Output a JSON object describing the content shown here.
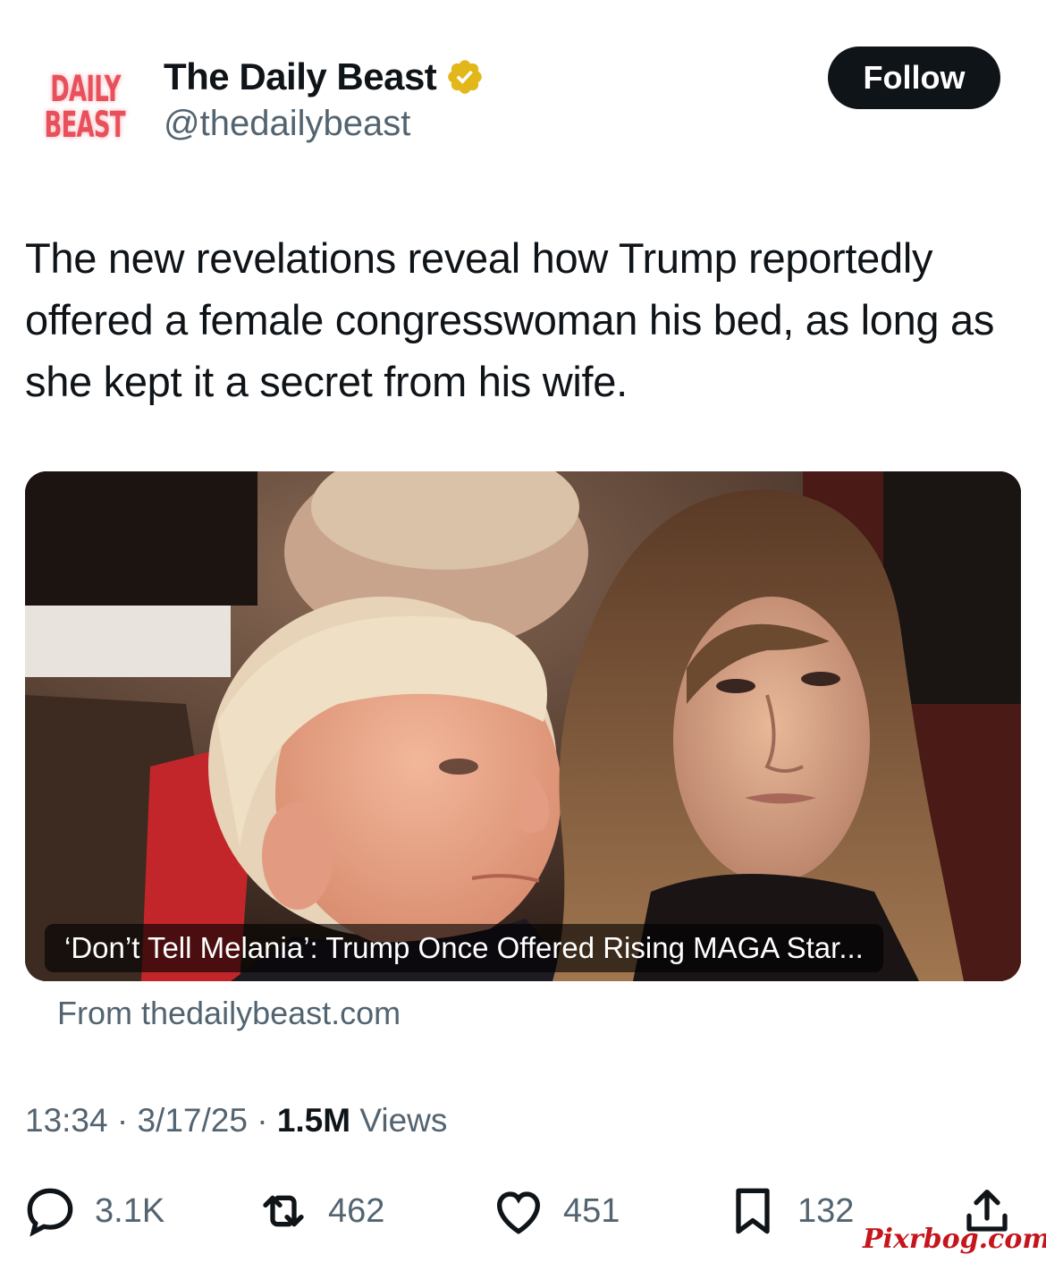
{
  "author": {
    "avatar_line1": "DAILY",
    "avatar_line2": "BEAST",
    "display_name": "The Daily Beast",
    "handle": "@thedailybeast",
    "verified_icon": "verified-gold-badge-icon"
  },
  "follow_label": "Follow",
  "tweet_text": "The new revelations reveal how Trump reportedly offered a female congresswoman his bed, as long as she kept it a secret from his wife.",
  "card": {
    "headline": "‘Don’t Tell Melania’: Trump Once Offered Rising MAGA Star...",
    "source": "From thedailybeast.com"
  },
  "meta": {
    "time": "13:34",
    "separator": "·",
    "date": "3/17/25",
    "views_count": "1.5M",
    "views_label": "Views"
  },
  "actions": {
    "replies": "3.1K",
    "retweets": "462",
    "likes": "451",
    "bookmarks": "132"
  },
  "watermark": "Pixrbog.com",
  "colors": {
    "primary_text": "#0f1419",
    "secondary_text": "#536471",
    "follow_bg": "#0f1419",
    "verified_gold": "#e2b719",
    "logo_red": "#e8505b"
  }
}
